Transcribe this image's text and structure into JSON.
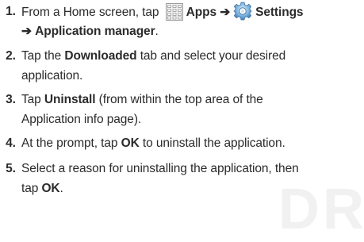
{
  "steps": [
    {
      "number": "1.",
      "line1_pre": "From a Home screen, tap ",
      "apps_label": "Apps",
      "arrow": "➔",
      "settings_label": "Settings",
      "line2_arrow": "➔",
      "line2_bold": "Application manager",
      "line2_post": "."
    },
    {
      "number": "2.",
      "pre": "Tap the ",
      "bold": "Downloaded",
      "post": " tab and select your desired",
      "line2": "application."
    },
    {
      "number": "3.",
      "pre": "Tap ",
      "bold": "Uninstall",
      "post": " (from within the top area of the",
      "line2": "Application info page)."
    },
    {
      "number": "4.",
      "pre": "At the prompt, tap ",
      "bold": "OK",
      "post": " to uninstall the application."
    },
    {
      "number": "5.",
      "line1": "Select a reason for uninstalling the application, then",
      "line2_pre": "tap ",
      "line2_bold": "OK",
      "line2_post": "."
    }
  ],
  "icons": {
    "apps": "apps-grid-icon",
    "settings": "settings-gear-icon"
  },
  "colors": {
    "text": "#2b2b2b",
    "apps_icon": "#9a9a9a",
    "settings_icon": "#4a90c8"
  },
  "watermark": "DR"
}
